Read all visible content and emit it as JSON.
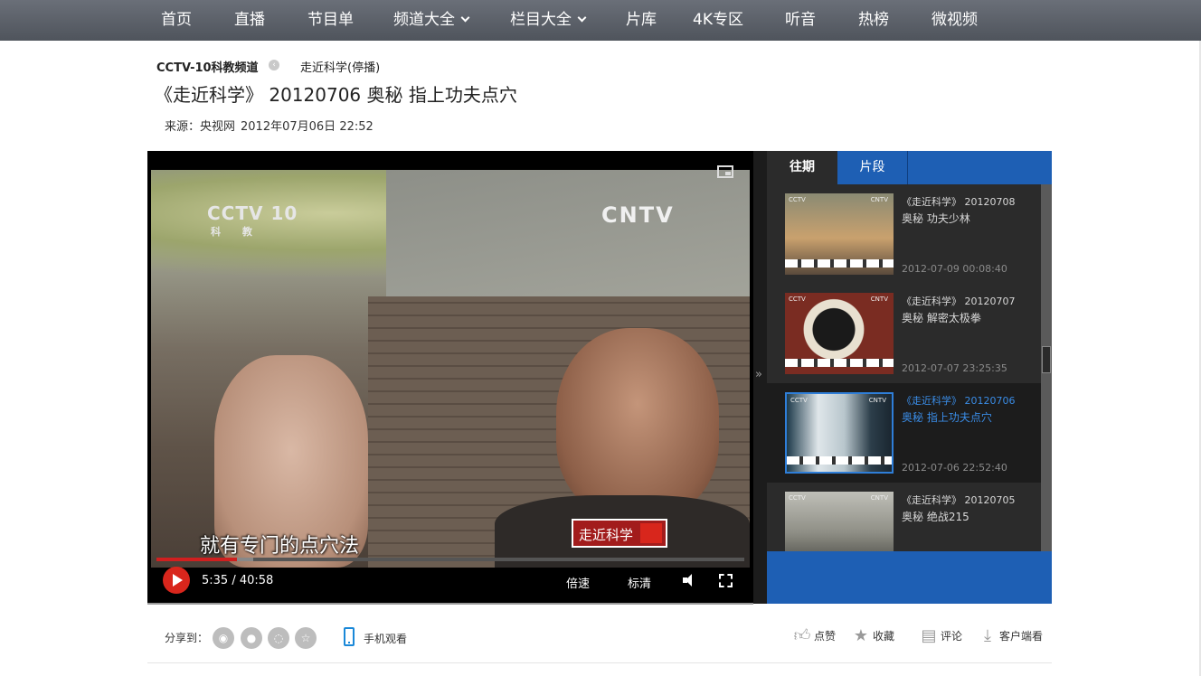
{
  "nav": {
    "items": [
      {
        "label": "首页",
        "caret": false
      },
      {
        "label": "直播",
        "caret": false
      },
      {
        "label": "节目单",
        "caret": false
      },
      {
        "label": "频道大全",
        "caret": true
      },
      {
        "label": "栏目大全",
        "caret": true
      },
      {
        "label": "片库",
        "caret": false
      },
      {
        "label": "4K专区",
        "caret": false
      },
      {
        "label": "听音",
        "caret": false
      },
      {
        "label": "热榜",
        "caret": false
      },
      {
        "label": "微视频",
        "caret": false
      }
    ]
  },
  "breadcrumb": {
    "channel": "CCTV-10科教频道",
    "program": "走近科学(停播)"
  },
  "page": {
    "title": "《走近科学》 20120706 奥秘 指上功夫点穴",
    "source_label": "来源：央视网",
    "published": "2012年07月06日 22:52"
  },
  "player": {
    "video_logo_left": "CCTV 10",
    "video_logo_left_sub": "科 教",
    "video_logo_right": "CNTV",
    "subtitle": "就有专门的点穴法",
    "program_logo": "走近科学",
    "time": "5:35 / 40:58",
    "played_fraction": 0.137,
    "buffered_fraction": 0.165,
    "speed_label": "倍速",
    "quality_label": "标清",
    "accent_color": "#d01f1f"
  },
  "sidebar": {
    "expander": "»",
    "tabs": [
      {
        "label": "往期",
        "active": true
      },
      {
        "label": "片段",
        "active": false
      }
    ],
    "episodes": [
      {
        "line1": "《走近科学》 20120708",
        "line2": "奥秘 功夫少林",
        "date": "2012-07-09 00:08:40",
        "active": false
      },
      {
        "line1": "《走近科学》 20120707",
        "line2": "奥秘 解密太极拳",
        "date": "2012-07-07 23:25:35",
        "active": false
      },
      {
        "line1": "《走近科学》 20120706",
        "line2": "奥秘 指上功夫点穴",
        "date": "2012-07-06 22:52:40",
        "active": true
      },
      {
        "line1": "《走近科学》 20120705",
        "line2": "奥秘 绝战215",
        "date": "",
        "active": false
      }
    ],
    "thumb_tag_left": "CCTV",
    "thumb_tag_right": "CNTV",
    "active_color": "#3a8ce6",
    "tab_color": "#1e5fb4"
  },
  "share": {
    "label": "分享到：",
    "targets": [
      "weibo-icon",
      "qq-icon",
      "wechat-icon",
      "favorite-star-icon"
    ],
    "mobile_label": "手机观看"
  },
  "actions": {
    "like": "点赞",
    "collect": "收藏",
    "comment": "评论",
    "client": "客户端看"
  }
}
